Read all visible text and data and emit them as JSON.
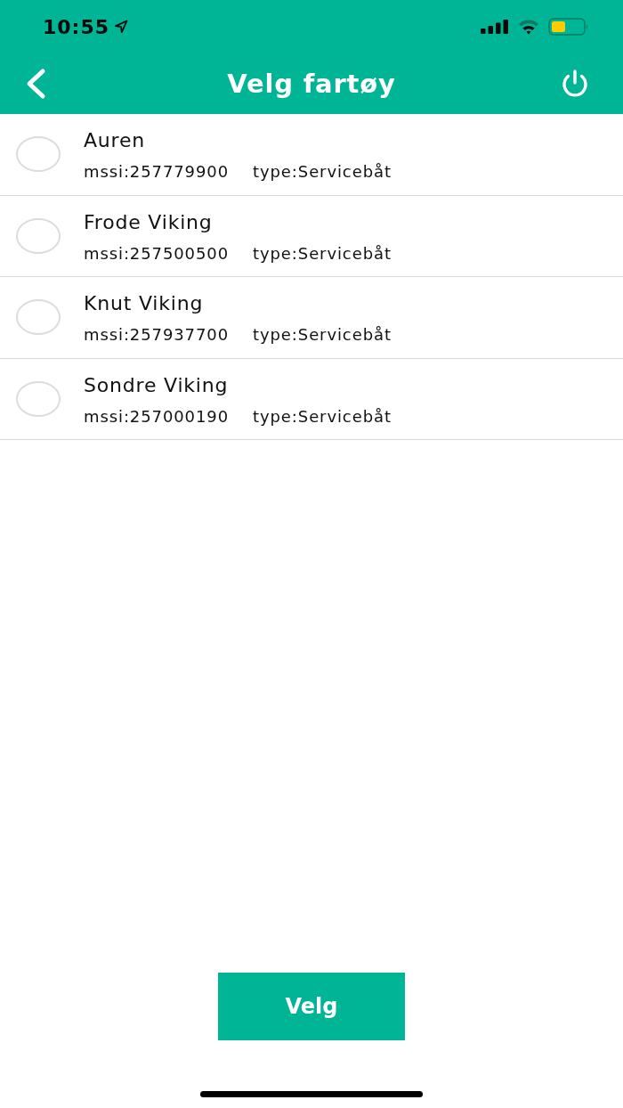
{
  "status_bar": {
    "time": "10:55"
  },
  "nav": {
    "title": "Velg fartøy"
  },
  "vessels": [
    {
      "name": "Auren",
      "mssi": "mssi:257779900",
      "type": "type:Servicebåt",
      "selected": false
    },
    {
      "name": "Frode Viking",
      "mssi": "mssi:257500500",
      "type": "type:Servicebåt",
      "selected": false
    },
    {
      "name": "Knut Viking",
      "mssi": "mssi:257937700",
      "type": "type:Servicebåt",
      "selected": false
    },
    {
      "name": "Sondre Viking",
      "mssi": "mssi:257000190",
      "type": "type:Servicebåt",
      "selected": false
    }
  ],
  "button": {
    "label": "Velg"
  }
}
